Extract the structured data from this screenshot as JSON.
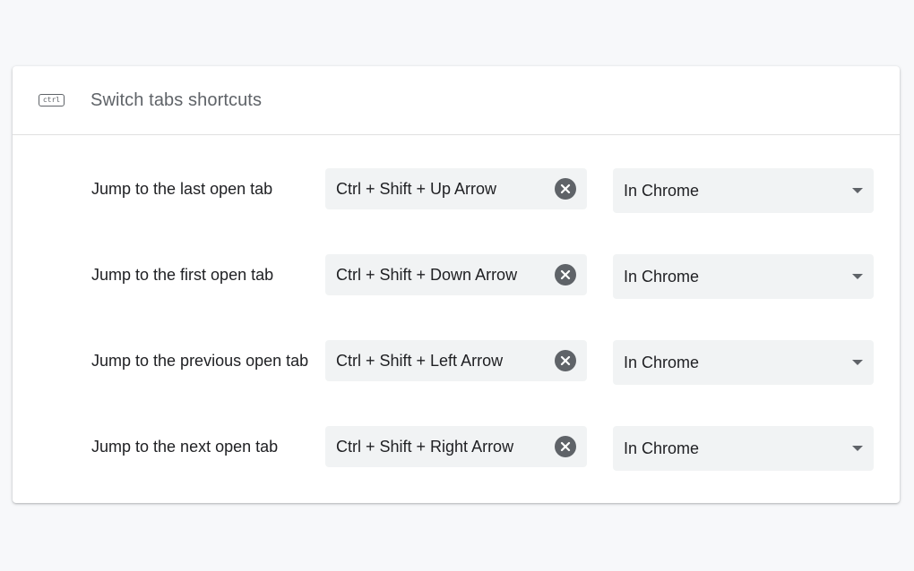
{
  "section": {
    "icon": "ctrl-key-icon",
    "icon_text": "ctrl",
    "title": "Switch tabs shortcuts"
  },
  "shortcuts": [
    {
      "label": "Jump to the last open tab",
      "keys": "Ctrl + Shift + Up Arrow",
      "scope": "In Chrome"
    },
    {
      "label": "Jump to the first open tab",
      "keys": "Ctrl + Shift + Down Arrow",
      "scope": "In Chrome"
    },
    {
      "label": "Jump to the previous open tab",
      "keys": "Ctrl + Shift + Left Arrow",
      "scope": "In Chrome"
    },
    {
      "label": "Jump to the next open tab",
      "keys": "Ctrl + Shift + Right Arrow",
      "scope": "In Chrome"
    }
  ],
  "colors": {
    "page_background": "#f7f8fa",
    "card_background": "#ffffff",
    "field_background": "#f1f3f4",
    "icon_gray": "#5f6368",
    "text": "#202124"
  }
}
